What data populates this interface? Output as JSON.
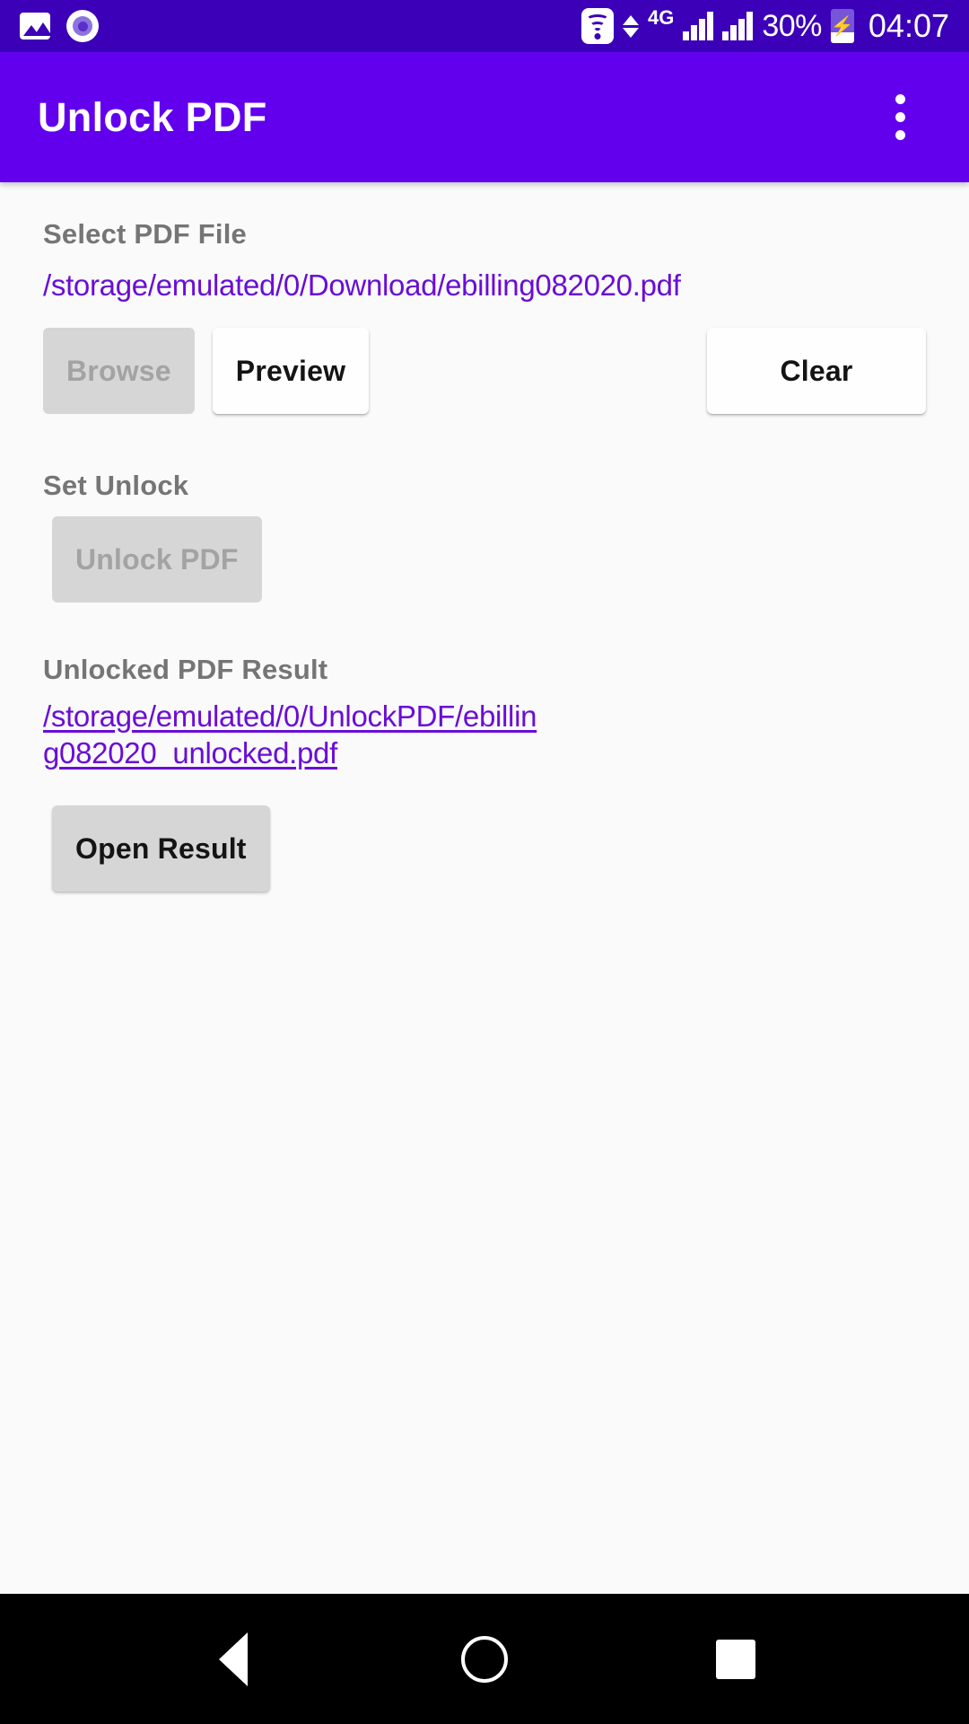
{
  "status_bar": {
    "left_icons": [
      "image-icon",
      "screen-record-icon"
    ],
    "wifi_icon": "wifi-icon",
    "data_transfer_icon": "data-updown-icon",
    "network_type": "4G",
    "signal_icons": [
      "signal-bars-sim1-icon",
      "signal-bars-sim2-icon"
    ],
    "battery_percent": "30%",
    "battery_icon": "battery-charging-icon",
    "charging_glyph": "⚡",
    "clock": "04:07"
  },
  "app_bar": {
    "title": "Unlock PDF",
    "overflow_icon": "overflow-menu-icon",
    "background_color": "#6200EE"
  },
  "main": {
    "select_section": {
      "label": "Select PDF File",
      "file_path": "/storage/emulated/0/Download/ebilling082020.pdf",
      "browse_label": "Browse",
      "browse_enabled": false,
      "preview_label": "Preview",
      "preview_enabled": true,
      "clear_label": "Clear",
      "clear_enabled": true
    },
    "set_unlock_section": {
      "label": "Set Unlock",
      "unlock_label": "Unlock PDF",
      "unlock_enabled": false
    },
    "result_section": {
      "label": "Unlocked PDF Result",
      "result_path": "/storage/emulated/0/UnlockPDF/ebilling082020_unlocked.pdf",
      "open_label": "Open Result",
      "open_enabled": true
    }
  },
  "nav_bar": {
    "back": "back-nav-icon",
    "home": "home-nav-icon",
    "recents": "recents-nav-icon"
  },
  "colors": {
    "status_bar": "#3B00B8",
    "accent": "#6200EE",
    "link": "#6A0DD6",
    "page_background": "#fafafa",
    "label_text": "#757575"
  }
}
